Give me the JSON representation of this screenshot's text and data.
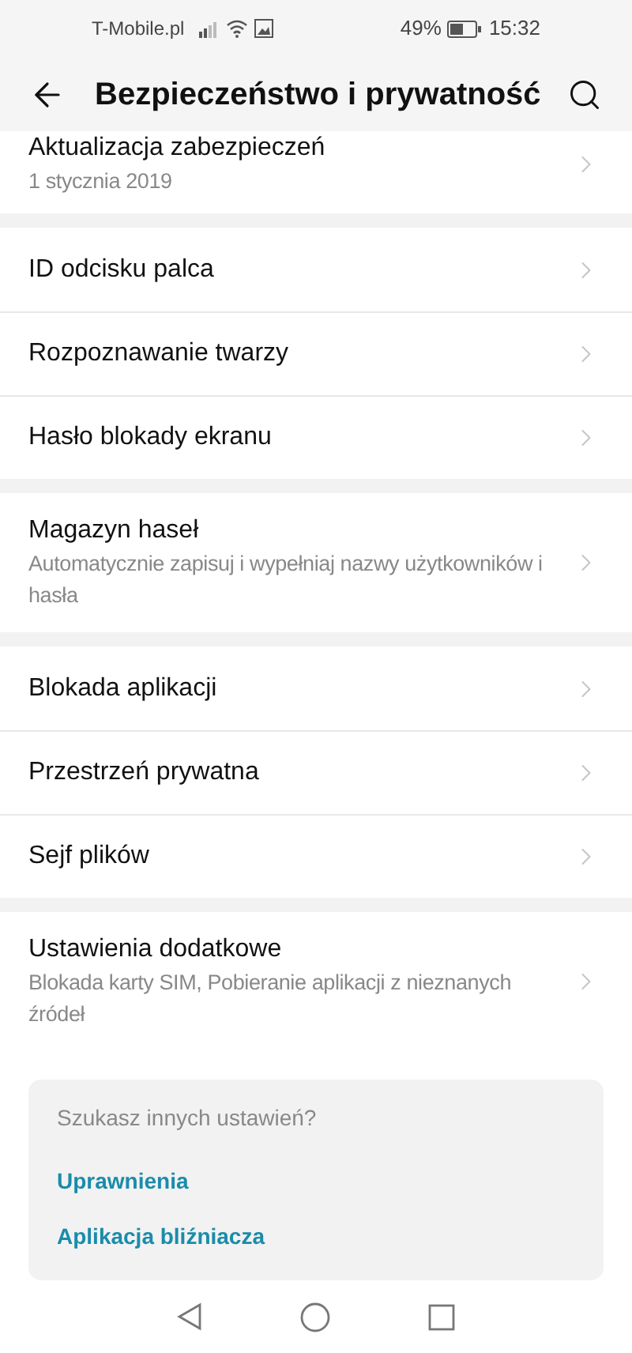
{
  "status_bar": {
    "carrier": "T-Mobile.pl",
    "battery": "49%",
    "time": "15:32"
  },
  "header": {
    "title": "Bezpieczeństwo i prywatność"
  },
  "sections": [
    {
      "rows": [
        {
          "title": "Aktualizacja zabezpieczeń",
          "subtitle": "1 stycznia 2019"
        }
      ]
    },
    {
      "rows": [
        {
          "title": "ID odcisku palca"
        },
        {
          "title": "Rozpoznawanie twarzy"
        },
        {
          "title": "Hasło blokady ekranu"
        }
      ]
    },
    {
      "rows": [
        {
          "title": "Magazyn haseł",
          "subtitle": "Automatycznie zapisuj i wypełniaj nazwy użytkowników i hasła"
        }
      ]
    },
    {
      "rows": [
        {
          "title": "Blokada aplikacji"
        },
        {
          "title": "Przestrzeń prywatna"
        },
        {
          "title": "Sejf plików"
        }
      ]
    },
    {
      "rows": [
        {
          "title": "Ustawienia dodatkowe",
          "subtitle": "Blokada karty SIM, Pobieranie aplikacji z nieznanych źródeł"
        }
      ]
    }
  ],
  "suggestions": {
    "heading": "Szukasz innych ustawień?",
    "links": [
      "Uprawnienia",
      "Aplikacja bliźniacza"
    ]
  }
}
